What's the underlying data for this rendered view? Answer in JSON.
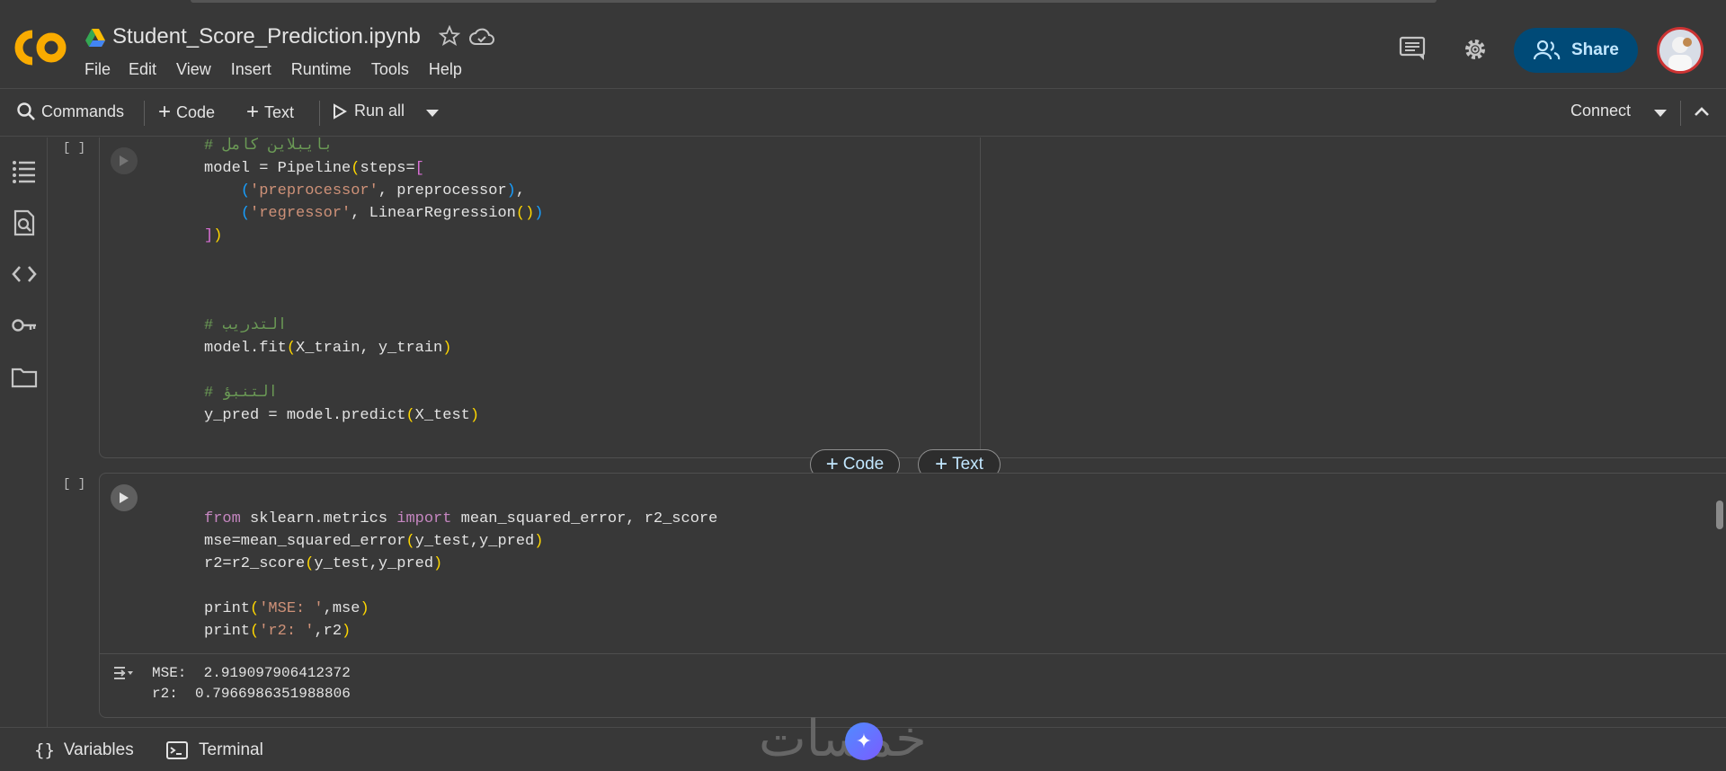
{
  "app": {
    "notebook_title": "Student_Score_Prediction.ipynb",
    "menu": [
      "File",
      "Edit",
      "View",
      "Insert",
      "Runtime",
      "Tools",
      "Help"
    ],
    "share_label": "Share"
  },
  "toolbar": {
    "commands": "Commands",
    "code": "Code",
    "text": "Text",
    "run_all": "Run all",
    "connect": "Connect"
  },
  "cells": [
    {
      "bracket": "[ ]",
      "lines": [
        "# بايبلاين كامل",
        "model = Pipeline(steps=[",
        "    ('preprocessor', preprocessor),",
        "    ('regressor', LinearRegression())",
        "])",
        "",
        "",
        "",
        "# التدريب",
        "model.fit(X_train, y_train)",
        "",
        "# التنبؤ",
        "y_pred = model.predict(X_test)"
      ]
    },
    {
      "bracket": "[ ]",
      "lines": [
        "from sklearn.metrics import mean_squared_error, r2_score",
        "mse=mean_squared_error(y_test,y_pred)",
        "r2=r2_score(y_test,y_pred)",
        "",
        "print('MSE: ',mse)",
        "print('r2: ',r2)"
      ],
      "output": [
        "MSE:  2.919097906412372",
        "r2:  0.7966986351988806"
      ]
    }
  ],
  "add_cell": {
    "code": "Code",
    "text": "Text"
  },
  "bottom": {
    "variables": "Variables",
    "terminal": "Terminal"
  },
  "watermark": "خمسات",
  "colors": {
    "share_bg": "#004a77",
    "share_text": "#c2e7ff",
    "comment": "#6a9955",
    "string": "#ce9178",
    "keyword": "#c586c0"
  }
}
